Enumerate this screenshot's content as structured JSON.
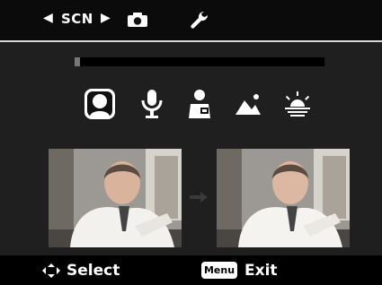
{
  "top_bar": {
    "mode_label": "SCN",
    "icons": [
      "left-arrow",
      "right-arrow",
      "camera-icon",
      "wrench-icon"
    ]
  },
  "progress": {
    "value": 0.02
  },
  "scenes": {
    "items": [
      {
        "name": "portrait-scene-icon",
        "selected": true
      },
      {
        "name": "microphone-scene-icon",
        "selected": false
      },
      {
        "name": "businessman-scene-icon",
        "selected": false
      },
      {
        "name": "landscape-scene-icon",
        "selected": false
      },
      {
        "name": "sunset-scene-icon",
        "selected": false
      }
    ]
  },
  "previews": {
    "before_label": "before-preview",
    "after_label": "after-preview"
  },
  "bottom_bar": {
    "select_hint": "Select",
    "menu_badge": "Menu",
    "exit_hint": "Exit"
  },
  "colors": {
    "background": "#1f1f1f",
    "top_bar": "#0b0b0b",
    "bottom_bar": "#000000",
    "accent_white": "#ffffff"
  }
}
